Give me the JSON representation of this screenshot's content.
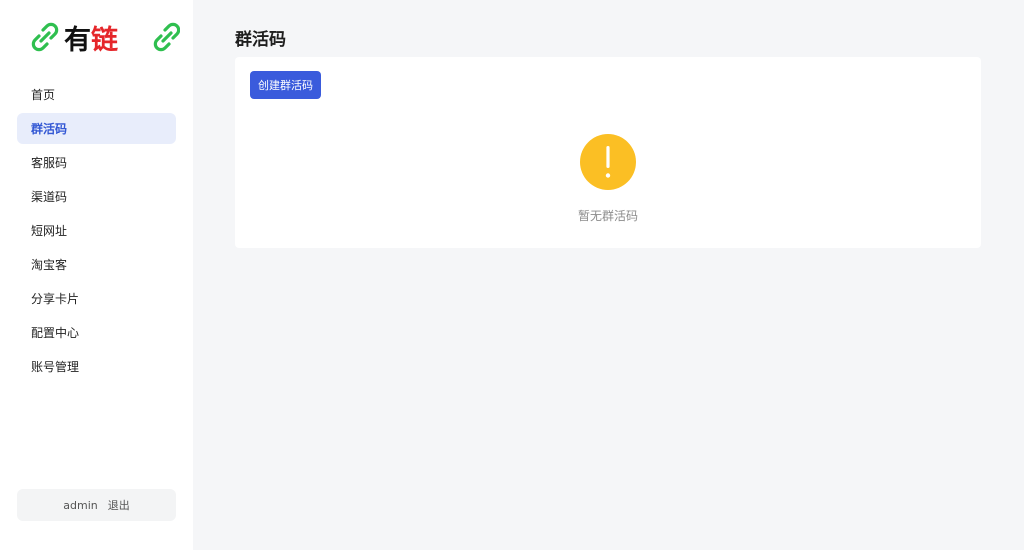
{
  "brand": {
    "name_part1": "有",
    "name_part2": "链",
    "text_color": "#111111",
    "accent_color": "#e5262a",
    "icon": "link-icon",
    "icon_color": "#2fbf4f"
  },
  "sidebar": {
    "items": [
      {
        "label": "首页",
        "active": false
      },
      {
        "label": "群活码",
        "active": true
      },
      {
        "label": "客服码",
        "active": false
      },
      {
        "label": "渠道码",
        "active": false
      },
      {
        "label": "短网址",
        "active": false
      },
      {
        "label": "淘宝客",
        "active": false
      },
      {
        "label": "分享卡片",
        "active": false
      },
      {
        "label": "配置中心",
        "active": false
      },
      {
        "label": "账号管理",
        "active": false
      }
    ],
    "active_color": "#3358d4",
    "active_bg": "#e8edfb"
  },
  "user": {
    "name": "admin",
    "logout_label": "退出"
  },
  "main": {
    "title": "群活码",
    "create_button_label": "创建群活码",
    "button_color": "#3a5bdc",
    "empty": {
      "icon": "warning-icon",
      "icon_color": "#fbbf24",
      "text": "暂无群活码"
    }
  }
}
